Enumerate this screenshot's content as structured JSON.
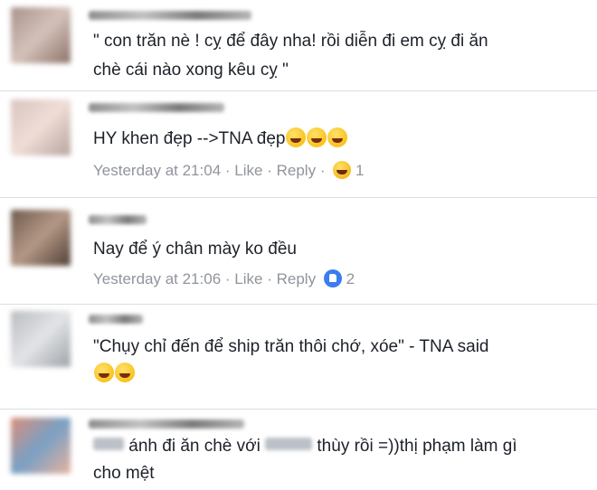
{
  "comments": [
    {
      "text_line1": "\" con trăn nè ! cỵ để đây nha! rồi diễn đi em cỵ đi ăn",
      "text_line2": "chè cái nào xong kêu cỵ \""
    },
    {
      "text": "HY khen đẹp -->TNA đẹp",
      "time": "Yesterday at 21:04",
      "like": "Like",
      "reply": "Reply",
      "reaction_icon": "haha-icon",
      "reaction_count": "1"
    },
    {
      "text": "Nay để ý chân mày ko đều",
      "time": "Yesterday at 21:06",
      "like": "Like",
      "reply": "Reply",
      "reaction_icon": "like-icon",
      "reaction_count": "2"
    },
    {
      "text": "\"Chụy chỉ đến để ship trăn thôi chớ, xóe\" - TNA said"
    },
    {
      "text_line1_a": "ánh đi ăn chè với",
      "text_line1_b": "thùy rồi =))thị phạm làm gì",
      "text_line2": "cho mệt"
    }
  ],
  "meta_separator": "·",
  "colors": {
    "text": "#1d2129",
    "meta": "#90949c",
    "divider": "#dddfe2",
    "like_blue": "#3b7cf0"
  }
}
